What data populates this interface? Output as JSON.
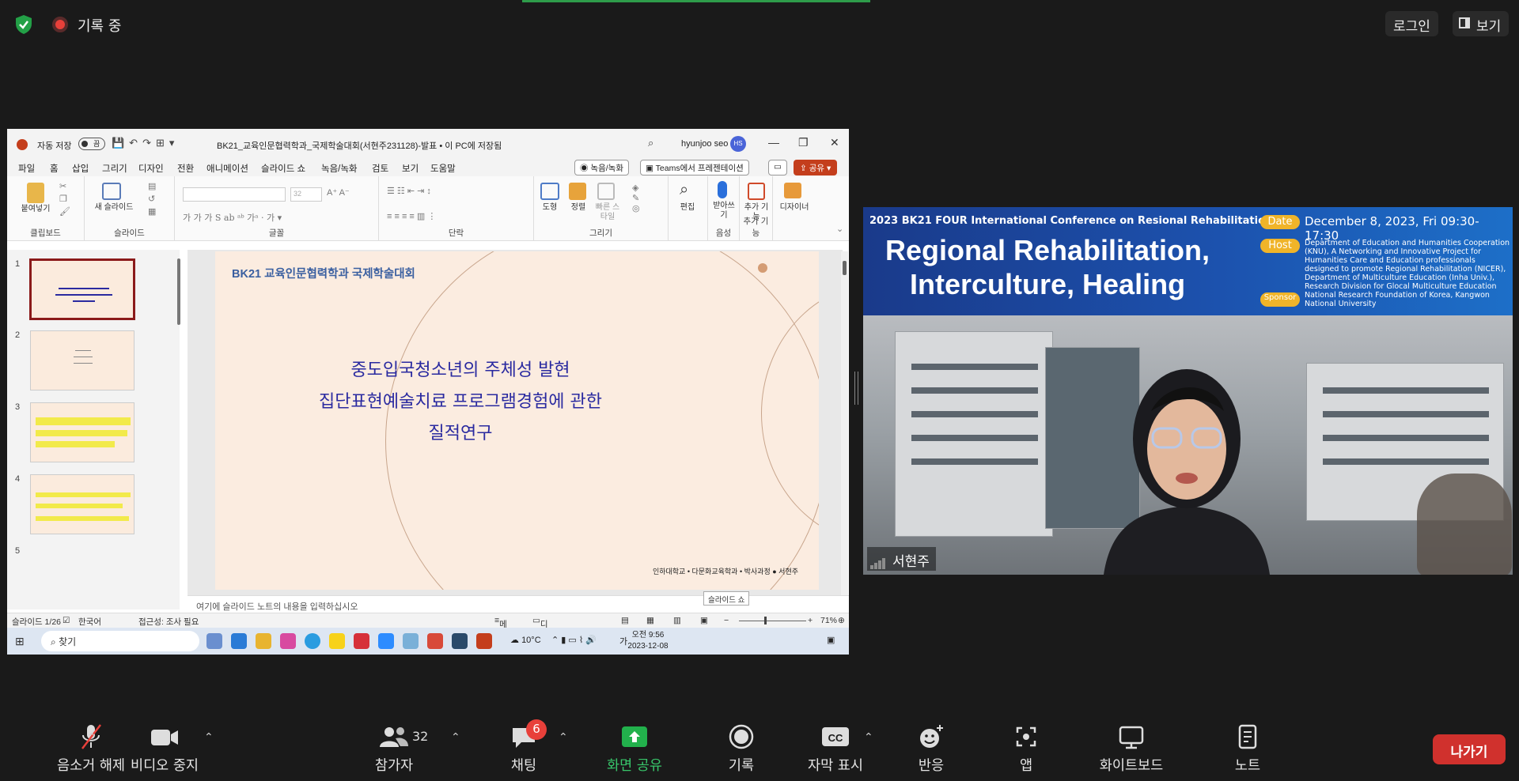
{
  "topbar": {
    "recording": "기록 중",
    "login": "로그인",
    "view": "보기"
  },
  "ppt": {
    "autosave": "자동 저장",
    "autosave_state": "끔",
    "doc_title": "BK21_교육인문협력학과_국제학술대회(서현주231128)-발표 • 이 PC에 저장됨",
    "user": "hyunjoo seo",
    "user_initials": "HS",
    "menu": [
      "파일",
      "홈",
      "삽입",
      "그리기",
      "디자인",
      "전환",
      "애니메이션",
      "슬라이드 쇼",
      "녹음/녹화",
      "검토",
      "보기",
      "도움말"
    ],
    "record_btn": "녹음/녹화",
    "teams_btn": "Teams에서 프레젠테이션",
    "share_btn": "공유",
    "ribbon": {
      "paste": "붙여넣기",
      "new_slide": "새 슬라이드",
      "font_size": "32",
      "shape": "도형",
      "arrange": "정렬",
      "quick_style": "빠른 스타일",
      "edit": "편집",
      "dictate": "받아쓰기",
      "addin": "추가 기능",
      "designer": "디자이너",
      "groups": [
        "클립보드",
        "슬라이드",
        "글꼴",
        "단락",
        "그리기",
        "음성",
        "추가 기능"
      ]
    },
    "thumb_numbers": [
      "1",
      "2",
      "3",
      "4",
      "5"
    ],
    "slide": {
      "header": "BK21 교육인문협력학과 국제학술대회",
      "line1": "중도입국청소년의 주체성 발현",
      "line2": "집단표현예술치료 프로그램경험에 관한",
      "line3": "질적연구",
      "footer": "인하대학교 • 다문화교육학과 • 박사과정 ● 서현주"
    },
    "notes_placeholder": "여기에 슬라이드 노트의 내용을 입력하십시오",
    "tooltip": "슬라이드 쇼",
    "status": {
      "slide_count": "슬라이드 1/26",
      "language": "한국어",
      "accessibility": "접근성: 조사 필요",
      "notes": "메모",
      "display": "디스플레이 설정",
      "zoom": "71%"
    },
    "taskbar": {
      "search": "찾기",
      "weather": "10°C",
      "ime": "가",
      "time": "오전 9:56",
      "date": "2023-12-08"
    }
  },
  "video": {
    "conference": "2023 BK21 FOUR International Conference on Resional Rehabilitation",
    "title1": "Regional Rehabilitation,",
    "title2": "Interculture, Healing",
    "date_label": "Date",
    "date": "December 8, 2023, Fri 09:30-17:30",
    "host_label": "Host",
    "host": "Department of Education and Humanities Cooperation (KNU), A Networking and Innovative Project for Humanities Care and Education professionals designed to promote Regional Rehabilitation (NICER), Department of Multiculture Education (Inha Univ.), Research Division for Glocal Multiculture Education",
    "sponsor_label": "Sponsor",
    "sponsor": "National Research Foundation of Korea, Kangwon National University",
    "participant_name": "서현주"
  },
  "toolbar": {
    "unmute": "음소거 해제",
    "stop_video": "비디오 중지",
    "participants": "참가자",
    "participant_count": "32",
    "chat": "채팅",
    "chat_badge": "6",
    "share_screen": "화면 공유",
    "record": "기록",
    "captions": "자막 표시",
    "reactions": "반응",
    "apps": "앱",
    "whiteboard": "화이트보드",
    "notes": "노트",
    "leave": "나가기"
  },
  "colors": {
    "share_green": "#22b14c",
    "leave_red": "#d0312d",
    "ppt_accent": "#c43e1c",
    "slide_text": "#2a2aa0"
  }
}
